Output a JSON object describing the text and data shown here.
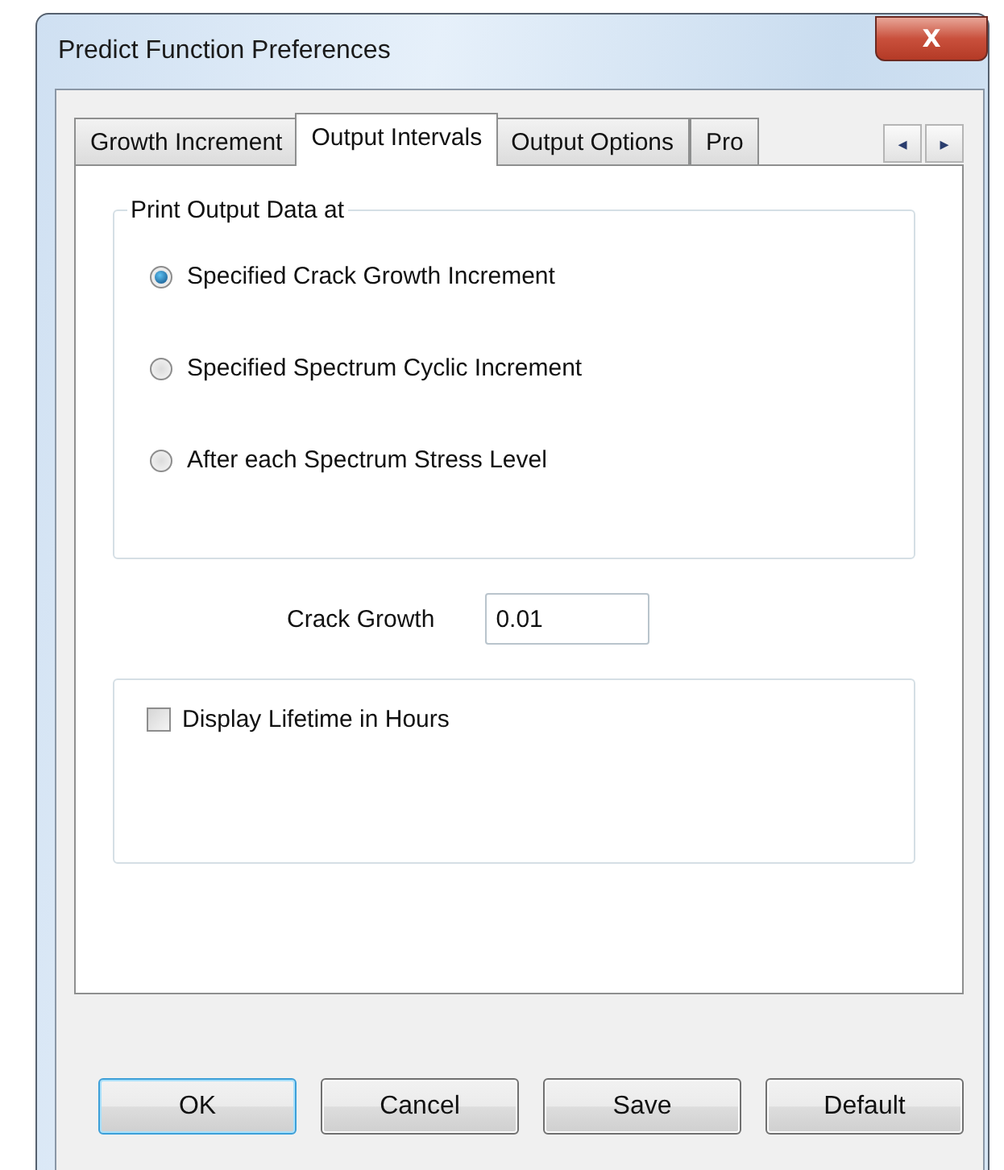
{
  "window": {
    "title": "Predict Function Preferences",
    "close_label": "X"
  },
  "tabs": [
    {
      "label": "Growth Increment",
      "selected": false
    },
    {
      "label": "Output Intervals",
      "selected": true
    },
    {
      "label": "Output Options",
      "selected": false
    },
    {
      "label": "Pro",
      "selected": false
    }
  ],
  "tab_scroll": [
    "◂",
    "▸"
  ],
  "print_group": {
    "title": "Print Output Data at",
    "options": [
      {
        "label": "Specified Crack Growth Increment",
        "selected": true
      },
      {
        "label": "Specified Spectrum Cyclic Increment",
        "selected": false
      },
      {
        "label": "After each Spectrum Stress Level",
        "selected": false
      }
    ]
  },
  "crack_growth": {
    "label": "Crack Growth",
    "value": "0.01"
  },
  "display_lifetime": {
    "label": "Display Lifetime in Hours",
    "checked": false
  },
  "buttons": [
    {
      "label": "OK",
      "default": true
    },
    {
      "label": "Cancel",
      "default": false
    },
    {
      "label": "Save",
      "default": false
    },
    {
      "label": "Default",
      "default": false
    }
  ]
}
